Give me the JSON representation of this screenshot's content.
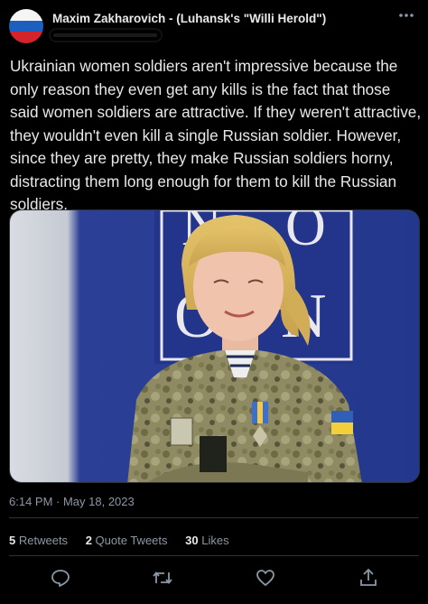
{
  "header": {
    "display_name": "Maxim Zakharovich - (Luhansk's \"Willi Herold\")",
    "flag_colors": [
      "#f5f5f5",
      "#1d5fbf",
      "#d3242b"
    ],
    "more_icon": "more-horizontal-icon"
  },
  "tweet": {
    "text": "Ukrainian women soldiers aren't impressive because the only reason they even get any kills is the fact that those said women soldiers are attractive. If they weren't attractive, they wouldn't even kill a single Russian soldier. However, since they are pretty, they make Russian soldiers horny, distracting them long enough for them to kill the Russian soldiers.",
    "timestamp": "6:14 PM · May 18, 2023"
  },
  "stats": {
    "retweets_count": "5",
    "retweets_label": "Retweets",
    "quotes_count": "2",
    "quotes_label": "Quote Tweets",
    "likes_count": "30",
    "likes_label": "Likes"
  },
  "actions": {
    "icons": [
      "reply-icon",
      "retweet-icon",
      "like-icon",
      "share-icon"
    ],
    "color": "#8b98a5"
  },
  "colors": {
    "background": "#000000",
    "text": "#e7e9ea",
    "secondary": "#8b98a5",
    "border": "#2f3336"
  }
}
